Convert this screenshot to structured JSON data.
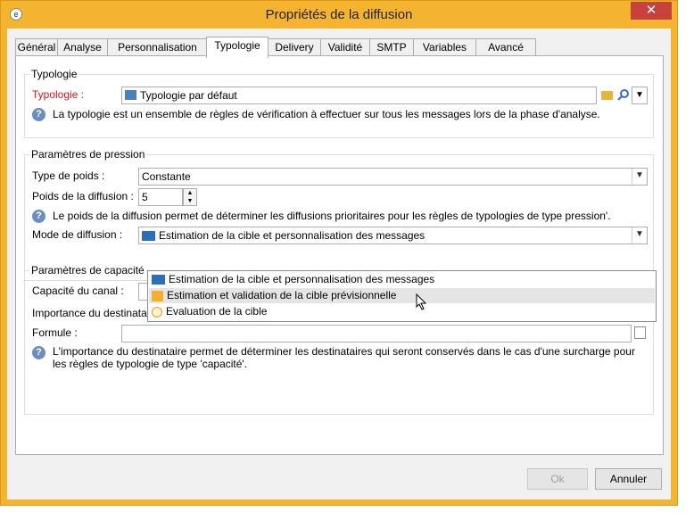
{
  "window": {
    "title": "Propriétés de la diffusion",
    "minimize": "–",
    "maximize": "□",
    "close": "✕"
  },
  "tabs": [
    {
      "label": "Général"
    },
    {
      "label": "Analyse"
    },
    {
      "label": "Personnalisation"
    },
    {
      "label": "Typologie"
    },
    {
      "label": "Delivery"
    },
    {
      "label": "Validité"
    },
    {
      "label": "SMTP"
    },
    {
      "label": "Variables"
    },
    {
      "label": "Avancé"
    }
  ],
  "active_tab": "Typologie",
  "typologie_group": {
    "title": "Typologie",
    "label": "Typologie :",
    "value": "Typologie par défaut",
    "note": "La typologie est un ensemble de règles de vérification à effectuer sur tous les messages lors de la phase d'analyse."
  },
  "pression_group": {
    "title": "Paramètres de pression",
    "type_poids_label": "Type de poids :",
    "type_poids_value": "Constante",
    "poids_label": "Poids de la diffusion :",
    "poids_value": "5",
    "note": "Le poids de la diffusion permet de déterminer les diffusions prioritaires pour les règles de typologies de type  pression'.",
    "mode_label": "Mode de diffusion :",
    "mode_value": "Estimation de la cible et personnalisation des messages"
  },
  "mode_dropdown": {
    "options": [
      "Estimation de la cible et personnalisation des messages",
      "Estimation et validation de la cible prévisionnelle",
      "Evaluation de la cible"
    ],
    "highlighted_index": 1
  },
  "capacite_group": {
    "title": "Paramètres de capacité",
    "canal_label": "Capacité du canal :",
    "importance_title": "Importance du destinataire",
    "formule_label": "Formule :",
    "formule_value": "",
    "note_line1": "L'importance du destinataire permet de déterminer les destinataires qui seront conservés dans le cas d'une surcharge pour",
    "note_line2": "les règles de typologie de type 'capacité'."
  },
  "buttons": {
    "ok": "Ok",
    "cancel": "Annuler"
  },
  "colors": {
    "frame": "#f4b42f",
    "close": "#c7423a",
    "required_label": "#d0141d",
    "info_icon": "#6a8ec1"
  }
}
